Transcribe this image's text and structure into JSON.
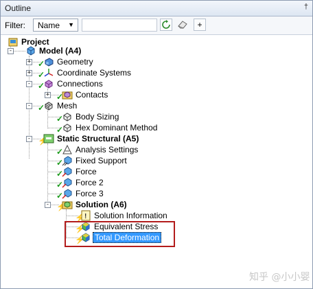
{
  "window": {
    "title": "Outline",
    "pin_icon": "pin-icon"
  },
  "toolbar": {
    "filter_label": "Filter:",
    "filter_value": "Name",
    "search_value": "",
    "buttons": [
      "refresh-icon",
      "eraser-icon",
      "expand-all-icon"
    ]
  },
  "tree": {
    "project": "Project",
    "model": "Model (A4)",
    "geometry": "Geometry",
    "coordinate_systems": "Coordinate Systems",
    "connections": "Connections",
    "contacts": "Contacts",
    "mesh": "Mesh",
    "body_sizing": "Body Sizing",
    "hex_dominant": "Hex Dominant Method",
    "static_structural": "Static Structural (A5)",
    "analysis_settings": "Analysis Settings",
    "fixed_support": "Fixed Support",
    "force": "Force",
    "force2": "Force 2",
    "force3": "Force 3",
    "solution": "Solution (A6)",
    "solution_information": "Solution Information",
    "equivalent_stress": "Equivalent Stress",
    "total_deformation": "Total Deformation"
  },
  "selected_item": "Total Deformation",
  "highlight_color": "#b31b1b",
  "selection_color": "#3399ff",
  "watermark": "知乎 @小小婴"
}
